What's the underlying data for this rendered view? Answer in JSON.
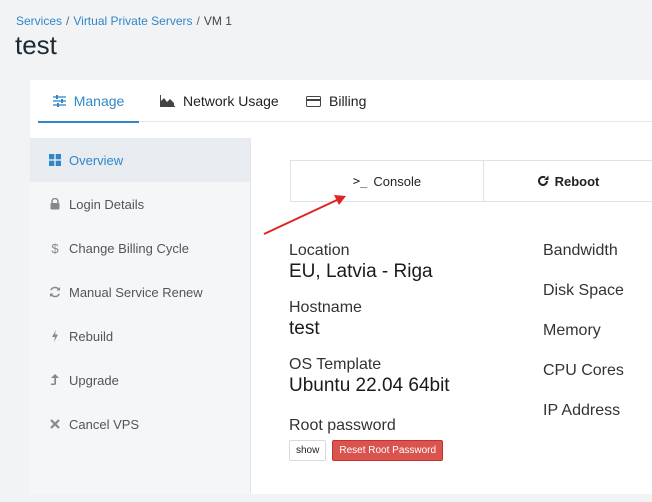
{
  "breadcrumb": {
    "items": [
      "Services",
      "Virtual Private Servers",
      "VM 1"
    ],
    "separator": "/"
  },
  "page_title": "test",
  "tabs": [
    {
      "label": "Manage",
      "icon": "sliders-icon",
      "active": true
    },
    {
      "label": "Network Usage",
      "icon": "area-chart-icon",
      "active": false
    },
    {
      "label": "Billing",
      "icon": "credit-card-icon",
      "active": false
    }
  ],
  "sidebar": {
    "items": [
      {
        "label": "Overview",
        "icon": "grid-icon",
        "active": true
      },
      {
        "label": "Login Details",
        "icon": "lock-icon",
        "active": false
      },
      {
        "label": "Change Billing Cycle",
        "icon": "dollar-icon",
        "active": false
      },
      {
        "label": "Manual Service Renew",
        "icon": "refresh-icon",
        "active": false
      },
      {
        "label": "Rebuild",
        "icon": "bolt-icon",
        "active": false
      },
      {
        "label": "Upgrade",
        "icon": "upgrade-arrow-icon",
        "active": false
      },
      {
        "label": "Cancel VPS",
        "icon": "times-icon",
        "active": false
      }
    ]
  },
  "actions": {
    "console_label": "Console",
    "reboot_label": "Reboot"
  },
  "details_left": [
    {
      "label": "Location",
      "value": "EU, Latvia - Riga"
    },
    {
      "label": "Hostname",
      "value": "test"
    },
    {
      "label": "OS Template",
      "value": "Ubuntu 22.04 64bit"
    },
    {
      "label": "Root password",
      "value": ""
    }
  ],
  "details_right": [
    {
      "label": "Bandwidth"
    },
    {
      "label": "Disk Space"
    },
    {
      "label": "Memory"
    },
    {
      "label": "CPU Cores"
    },
    {
      "label": "IP Address"
    }
  ],
  "password": {
    "show_label": "show",
    "reset_label": "Reset Root Password"
  },
  "colors": {
    "accent": "#2f86c9",
    "danger": "#d9534f",
    "annotation_arrow": "#e02424"
  }
}
